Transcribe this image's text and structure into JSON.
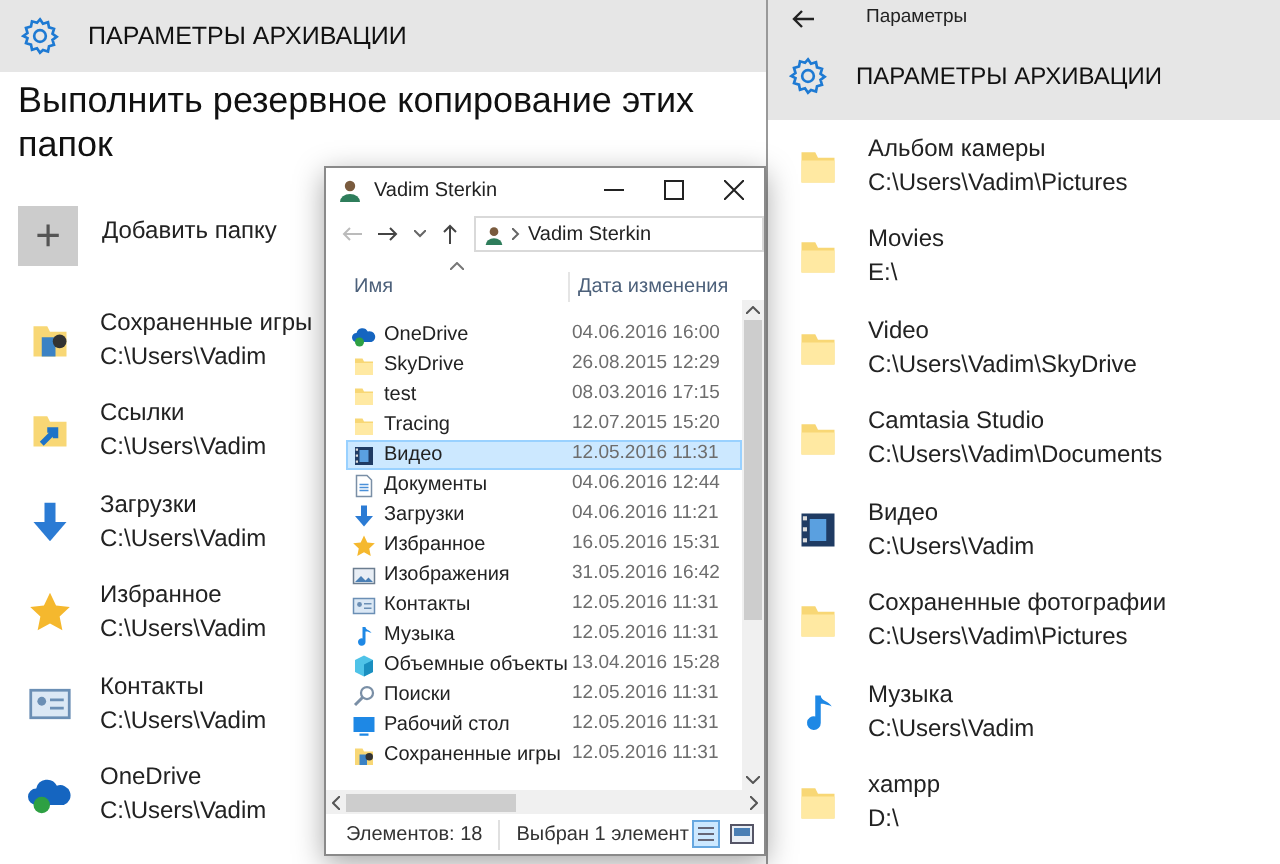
{
  "left": {
    "header_title": "ПАРАМЕТРЫ АРХИВАЦИИ",
    "heading": "Выполнить резервное копирование этих папок",
    "add_folder": {
      "symbol": "+",
      "label": "Добавить папку"
    },
    "folders": [
      {
        "name": "Сохраненные игры",
        "path": "C:\\Users\\Vadim",
        "kind": "games"
      },
      {
        "name": "Ссылки",
        "path": "C:\\Users\\Vadim",
        "kind": "links"
      },
      {
        "name": "Загрузки",
        "path": "C:\\Users\\Vadim",
        "kind": "downloads"
      },
      {
        "name": "Избранное",
        "path": "C:\\Users\\Vadim",
        "kind": "favorites"
      },
      {
        "name": "Контакты",
        "path": "C:\\Users\\Vadim",
        "kind": "contacts"
      },
      {
        "name": "OneDrive",
        "path": "C:\\Users\\Vadim",
        "kind": "onedrive"
      }
    ]
  },
  "explorer": {
    "title": "Vadim Sterkin",
    "breadcrumb": "Vadim Sterkin",
    "columns": [
      "Имя",
      "Дата изменения"
    ],
    "rows": [
      {
        "name": "OneDrive",
        "date": "04.06.2016 16:00",
        "kind": "onedrive",
        "selected": false
      },
      {
        "name": "SkyDrive",
        "date": "26.08.2015 12:29",
        "kind": "folder",
        "selected": false
      },
      {
        "name": "test",
        "date": "08.03.2016 17:15",
        "kind": "folder",
        "selected": false
      },
      {
        "name": "Tracing",
        "date": "12.07.2015 15:20",
        "kind": "folder",
        "selected": false
      },
      {
        "name": "Видео",
        "date": "12.05.2016 11:31",
        "kind": "video",
        "selected": true
      },
      {
        "name": "Документы",
        "date": "04.06.2016 12:44",
        "kind": "documents",
        "selected": false
      },
      {
        "name": "Загрузки",
        "date": "04.06.2016 11:21",
        "kind": "downloads",
        "selected": false
      },
      {
        "name": "Избранное",
        "date": "16.05.2016 15:31",
        "kind": "favorites",
        "selected": false
      },
      {
        "name": "Изображения",
        "date": "31.05.2016 16:42",
        "kind": "pictures",
        "selected": false
      },
      {
        "name": "Контакты",
        "date": "12.05.2016 11:31",
        "kind": "contacts",
        "selected": false
      },
      {
        "name": "Музыка",
        "date": "12.05.2016 11:31",
        "kind": "music",
        "selected": false
      },
      {
        "name": "Объемные объекты",
        "date": "13.04.2016 15:28",
        "kind": "objects",
        "selected": false
      },
      {
        "name": "Поиски",
        "date": "12.05.2016 11:31",
        "kind": "searches",
        "selected": false
      },
      {
        "name": "Рабочий стол",
        "date": "12.05.2016 11:31",
        "kind": "desktop",
        "selected": false
      },
      {
        "name": "Сохраненные игры",
        "date": "12.05.2016 11:31",
        "kind": "games",
        "selected": false
      }
    ],
    "status_items": "Элементов: 18",
    "status_selection": "Выбран 1 элемент"
  },
  "right": {
    "back_label": "Параметры",
    "header_title": "ПАРАМЕТРЫ АРХИВАЦИИ",
    "folders": [
      {
        "name": "Альбом камеры",
        "path": "C:\\Users\\Vadim\\Pictures",
        "kind": "folder"
      },
      {
        "name": "Movies",
        "path": "E:\\",
        "kind": "folder"
      },
      {
        "name": "Video",
        "path": "C:\\Users\\Vadim\\SkyDrive",
        "kind": "folder"
      },
      {
        "name": "Camtasia Studio",
        "path": "C:\\Users\\Vadim\\Documents",
        "kind": "folder"
      },
      {
        "name": "Видео",
        "path": "C:\\Users\\Vadim",
        "kind": "video"
      },
      {
        "name": "Сохраненные фотографии",
        "path": "C:\\Users\\Vadim\\Pictures",
        "kind": "folder"
      },
      {
        "name": "Музыка",
        "path": "C:\\Users\\Vadim",
        "kind": "music"
      },
      {
        "name": "xampp",
        "path": "D:\\",
        "kind": "folder"
      }
    ]
  }
}
